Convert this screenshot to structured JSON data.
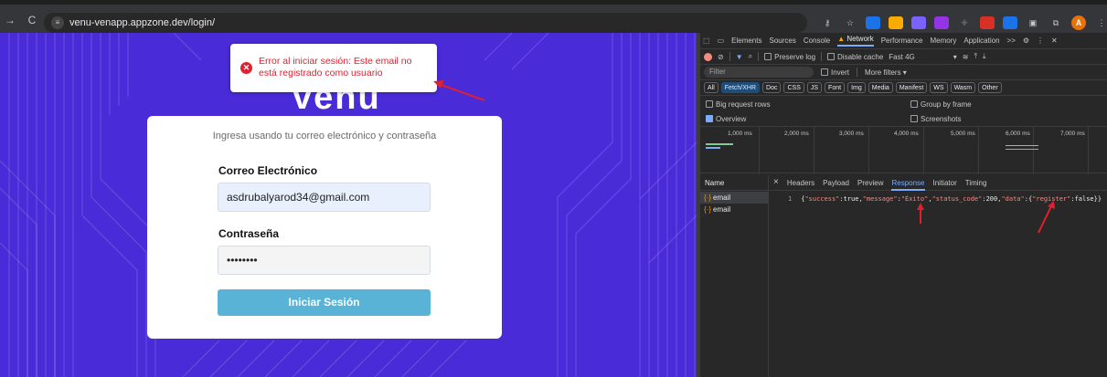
{
  "browser": {
    "url": "venu-venapp.appzone.dev/login/",
    "nav_back": "→",
    "nav_reload": "C",
    "avatar_letter": "A"
  },
  "page": {
    "logo": "venu",
    "toast_icon": "✕",
    "toast_message": "Error al iniciar sesión: Este email no está registrado como usuario",
    "subtitle": "Ingresa usando tu correo electrónico y contraseña",
    "email_label": "Correo Electrónico",
    "email_value": "asdrubalyarod34@gmail.com",
    "password_label": "Contraseña",
    "password_value": "••••••••",
    "login_button": "Iniciar Sesión",
    "colors": {
      "background": "#4a2bd8",
      "button": "#59b3d6",
      "error": "#e0202e"
    }
  },
  "devtools": {
    "tabs": [
      "Elements",
      "Sources",
      "Console",
      "Network",
      "Performance",
      "Memory",
      "Application",
      ">>"
    ],
    "active_tab": "Network",
    "preserve_log": "Preserve log",
    "disable_cache": "Disable cache",
    "throttle": "Fast 4G",
    "filter_placeholder": "Filter",
    "invert": "Invert",
    "more_filters": "More filters ▾",
    "type_chips": [
      "All",
      "Fetch/XHR",
      "Doc",
      "CSS",
      "JS",
      "Font",
      "Img",
      "Media",
      "Manifest",
      "WS",
      "Wasm",
      "Other"
    ],
    "active_chip": "Fetch/XHR",
    "big_request_rows": "Big request rows",
    "group_by_frame": "Group by frame",
    "overview": "Overview",
    "screenshots": "Screenshots",
    "timeline_ticks": [
      "1,000 ms",
      "2,000 ms",
      "3,000 ms",
      "4,000 ms",
      "5,000 ms",
      "6,000 ms",
      "7,000 ms"
    ],
    "name_header": "Name",
    "requests": [
      "email",
      "email"
    ],
    "detail_close": "×",
    "detail_tabs": [
      "Headers",
      "Payload",
      "Preview",
      "Response",
      "Initiator",
      "Timing"
    ],
    "active_detail_tab": "Response",
    "response_line_number": "1",
    "response_body": {
      "open": "{",
      "k1": "\"success\"",
      "v1": "true",
      "k2": "\"message\"",
      "v2": "\"Éxito\"",
      "k3": "\"status_code\"",
      "v3": "200",
      "k4": "\"data\"",
      "v4_open": "{",
      "k5": "\"register\"",
      "v5": "false",
      "close": "}}"
    }
  }
}
